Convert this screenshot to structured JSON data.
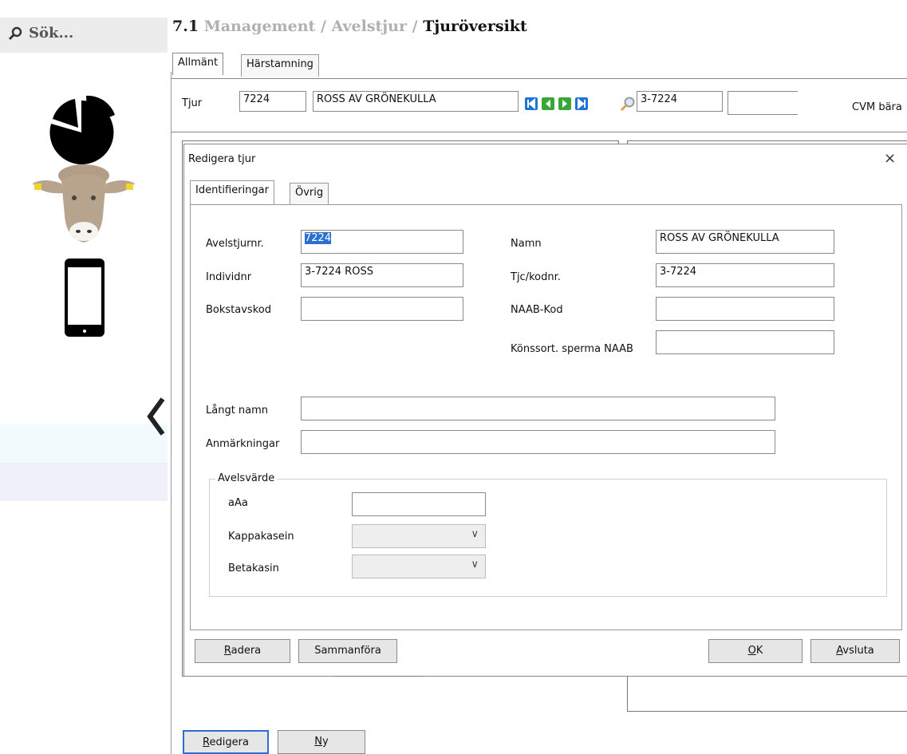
{
  "sidebar": {
    "search_label": "Sök...",
    "icons": [
      "search-icon",
      "pie-chart-icon",
      "cow-icon",
      "phone-icon",
      "collapse-chevron-icon"
    ]
  },
  "breadcrumb": {
    "number": "7.1",
    "level1": "Management",
    "sep1": "/",
    "level2": "Avelstjur",
    "sep2": "/",
    "current": "Tjuröversikt"
  },
  "main": {
    "tabs": [
      "Allmänt",
      "Härstamning"
    ],
    "tjur_label": "Tjur",
    "tjur_nr": "7224",
    "tjur_name": "ROSS AV GRÖNEKULLA",
    "tjur_code": "3-7224",
    "cvm_label": "CVM bära",
    "nav_colors": {
      "blue": "#1f73d6",
      "green": "#3aa63a"
    }
  },
  "dialog": {
    "title": "Redigera tjur",
    "close": "×",
    "tabs": [
      "Identifieringar",
      "Övrig"
    ],
    "fields": {
      "avelstjurnr_label": "Avelstjurnr.",
      "avelstjurnr_value": "7224",
      "individnr_label": "Individnr",
      "individnr_value": "3-7224 ROSS",
      "bokstavskod_label": "Bokstavskod",
      "bokstavskod_value": "",
      "namn_label": "Namn",
      "namn_value": "ROSS AV GRÖNEKULLA",
      "tjc_label": "Tjc/kodnr.",
      "tjc_value": "3-7224",
      "naab_label": "NAAB-Kod",
      "naab_value": "",
      "konssort_label": "Könssort. sperma NAAB",
      "konssort_value": "",
      "langt_namn_label": "Långt namn",
      "langt_namn_value": "",
      "anmarkningar_label": "Anmärkningar",
      "anmarkningar_value": ""
    },
    "avelsvarde": {
      "title": "Avelsvärde",
      "aaa_label": "aAa",
      "aaa_value": "",
      "kappakasein_label": "Kappakasein",
      "kappakasein_value": "",
      "betakasin_label": "Betakasin",
      "betakasin_value": ""
    },
    "buttons": {
      "radera_u": "R",
      "radera_rest": "adera",
      "sammanfora": "Sammanföra",
      "ok_u": "O",
      "ok_rest": "K",
      "avsluta_u": "A",
      "avsluta_rest": "vsluta"
    }
  },
  "footer": {
    "redigera_u": "R",
    "redigera_rest": "edigera",
    "ny_u": "N",
    "ny_rest": "y"
  },
  "colors": {
    "selection": "#2b6fcf",
    "primary_border": "#2d6fd1",
    "sidebar_search_bg": "#ececec"
  }
}
